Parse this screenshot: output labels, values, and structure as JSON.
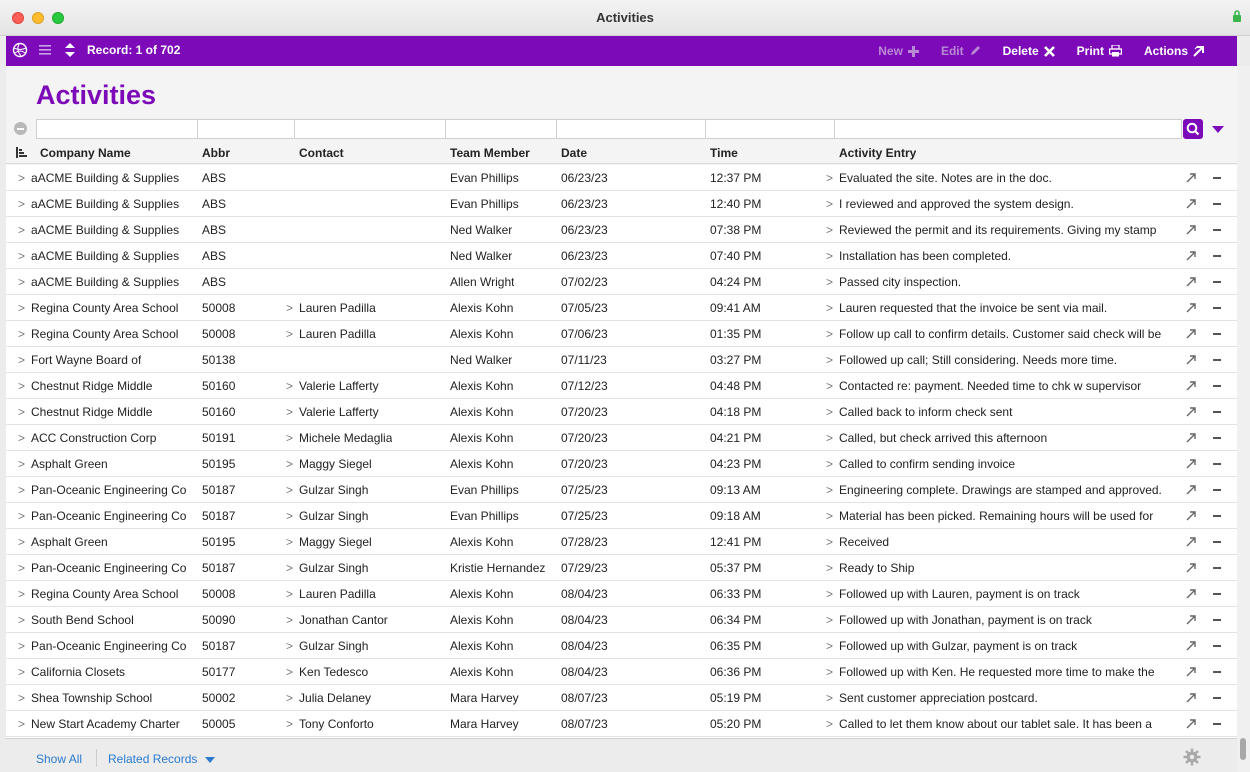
{
  "window": {
    "title": "Activities"
  },
  "toolbar": {
    "record_label": "Record: 1 of 702",
    "new_label": "New",
    "edit_label": "Edit",
    "delete_label": "Delete",
    "print_label": "Print",
    "actions_label": "Actions"
  },
  "page": {
    "title": "Activities"
  },
  "columns": [
    "Company Name",
    "Abbr",
    "Contact",
    "Team Member",
    "Date",
    "Time",
    "Activity Entry"
  ],
  "rows": [
    {
      "company": "aACME Building & Supplies",
      "abbr": "ABS",
      "contact": "",
      "member": "Evan Phillips",
      "date": "06/23/23",
      "time": "12:37 PM",
      "entry": "Evaluated the site. Notes are in the doc."
    },
    {
      "company": "aACME Building & Supplies",
      "abbr": "ABS",
      "contact": "",
      "member": "Evan Phillips",
      "date": "06/23/23",
      "time": "12:40 PM",
      "entry": "I reviewed and approved the system design."
    },
    {
      "company": "aACME Building & Supplies",
      "abbr": "ABS",
      "contact": "",
      "member": "Ned Walker",
      "date": "06/23/23",
      "time": "07:38 PM",
      "entry": "Reviewed the permit and its requirements. Giving my stamp"
    },
    {
      "company": "aACME Building & Supplies",
      "abbr": "ABS",
      "contact": "",
      "member": "Ned Walker",
      "date": "06/23/23",
      "time": "07:40 PM",
      "entry": "Installation has been completed."
    },
    {
      "company": "aACME Building & Supplies",
      "abbr": "ABS",
      "contact": "",
      "member": "Allen Wright",
      "date": "07/02/23",
      "time": "04:24 PM",
      "entry": "Passed city inspection."
    },
    {
      "company": "Regina County Area School",
      "abbr": "50008",
      "contact": "Lauren Padilla",
      "member": "Alexis Kohn",
      "date": "07/05/23",
      "time": "09:41 AM",
      "entry": "Lauren requested that the invoice be sent via mail."
    },
    {
      "company": "Regina County Area School",
      "abbr": "50008",
      "contact": "Lauren Padilla",
      "member": "Alexis Kohn",
      "date": "07/06/23",
      "time": "01:35 PM",
      "entry": "Follow up call to confirm details. Customer said check will be"
    },
    {
      "company": "Fort Wayne Board of",
      "abbr": "50138",
      "contact": "",
      "member": "Ned Walker",
      "date": "07/11/23",
      "time": "03:27 PM",
      "entry": "Followed up call; Still considering. Needs more time."
    },
    {
      "company": "Chestnut Ridge Middle",
      "abbr": "50160",
      "contact": "Valerie Lafferty",
      "member": "Alexis Kohn",
      "date": "07/12/23",
      "time": "04:48 PM",
      "entry": "Contacted re: payment. Needed time to chk w supervisor"
    },
    {
      "company": "Chestnut Ridge Middle",
      "abbr": "50160",
      "contact": "Valerie Lafferty",
      "member": "Alexis Kohn",
      "date": "07/20/23",
      "time": "04:18 PM",
      "entry": "Called back to inform check sent"
    },
    {
      "company": "ACC Construction Corp",
      "abbr": "50191",
      "contact": "Michele Medaglia",
      "member": "Alexis Kohn",
      "date": "07/20/23",
      "time": "04:21 PM",
      "entry": "Called, but check arrived this afternoon"
    },
    {
      "company": "Asphalt Green",
      "abbr": "50195",
      "contact": "Maggy Siegel",
      "member": "Alexis Kohn",
      "date": "07/20/23",
      "time": "04:23 PM",
      "entry": "Called to confirm sending invoice"
    },
    {
      "company": "Pan-Oceanic Engineering Co",
      "abbr": "50187",
      "contact": "Gulzar Singh",
      "member": "Evan Phillips",
      "date": "07/25/23",
      "time": "09:13 AM",
      "entry": "Engineering complete. Drawings are stamped and approved."
    },
    {
      "company": "Pan-Oceanic Engineering Co",
      "abbr": "50187",
      "contact": "Gulzar Singh",
      "member": "Evan Phillips",
      "date": "07/25/23",
      "time": "09:18 AM",
      "entry": "Material has been picked. Remaining hours will be used for"
    },
    {
      "company": "Asphalt Green",
      "abbr": "50195",
      "contact": "Maggy Siegel",
      "member": "Alexis Kohn",
      "date": "07/28/23",
      "time": "12:41 PM",
      "entry": "Received"
    },
    {
      "company": "Pan-Oceanic Engineering Co",
      "abbr": "50187",
      "contact": "Gulzar Singh",
      "member": "Kristie Hernandez",
      "date": "07/29/23",
      "time": "05:37 PM",
      "entry": "Ready to Ship"
    },
    {
      "company": "Regina County Area School",
      "abbr": "50008",
      "contact": "Lauren Padilla",
      "member": "Alexis Kohn",
      "date": "08/04/23",
      "time": "06:33 PM",
      "entry": "Followed up with Lauren, payment is on track"
    },
    {
      "company": "South Bend School",
      "abbr": "50090",
      "contact": "Jonathan Cantor",
      "member": "Alexis Kohn",
      "date": "08/04/23",
      "time": "06:34 PM",
      "entry": "Followed up with Jonathan, payment is on track"
    },
    {
      "company": "Pan-Oceanic Engineering Co",
      "abbr": "50187",
      "contact": "Gulzar Singh",
      "member": "Alexis Kohn",
      "date": "08/04/23",
      "time": "06:35 PM",
      "entry": "Followed up with Gulzar, payment is on track"
    },
    {
      "company": "California Closets",
      "abbr": "50177",
      "contact": "Ken Tedesco",
      "member": "Alexis Kohn",
      "date": "08/04/23",
      "time": "06:36 PM",
      "entry": "Followed up with Ken. He requested more time to make the"
    },
    {
      "company": "Shea Township School",
      "abbr": "50002",
      "contact": "Julia Delaney",
      "member": "Mara Harvey",
      "date": "08/07/23",
      "time": "05:19 PM",
      "entry": "Sent customer appreciation postcard."
    },
    {
      "company": "New Start Academy Charter",
      "abbr": "50005",
      "contact": "Tony Conforto",
      "member": "Mara Harvey",
      "date": "08/07/23",
      "time": "05:20 PM",
      "entry": "Called to let them know about our tablet sale. It has been a"
    }
  ],
  "footer": {
    "show_all": "Show All",
    "related_records": "Related Records"
  },
  "colors": {
    "accent": "#7d0ab8",
    "link": "#2a7bd0"
  }
}
